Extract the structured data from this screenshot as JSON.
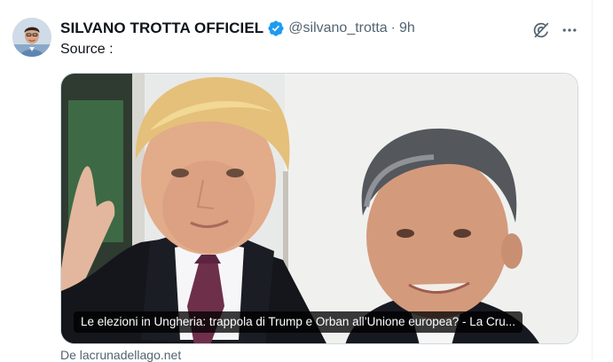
{
  "post": {
    "author_name": "SILVANO TROTTA OFFICIEL",
    "handle": "@silvano_trotta",
    "separator": "·",
    "time": "9h",
    "text": "Source :",
    "verified": true
  },
  "card": {
    "title": "Le elezioni in Ungheria: trappola di Trump e Orban all’Unione europea? - La Cru...",
    "source": "De lacrunadellago.net"
  },
  "icons": {
    "verified": "verified-badge-icon",
    "grok": "grok-icon",
    "more": "more-options-icon"
  },
  "colors": {
    "verified_blue": "#1d9bf0",
    "secondary_text": "#536471",
    "border": "#cfd9de"
  }
}
